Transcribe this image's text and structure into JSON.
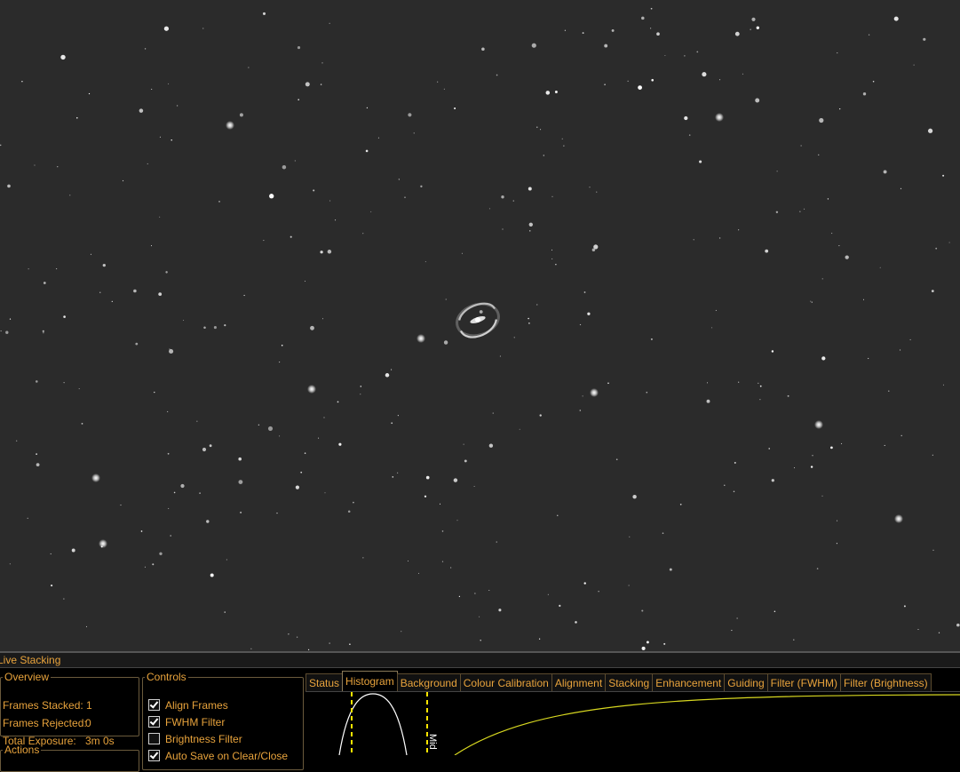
{
  "panel": {
    "title": "Live Stacking",
    "overview": {
      "legend": "Overview",
      "frames_stacked_label": "Frames Stacked:",
      "frames_stacked_value": "1",
      "frames_rejected_label": "Frames Rejected:",
      "frames_rejected_value": "0",
      "total_exposure_label": "Total Exposure:",
      "total_exposure_value": "3m 0s"
    },
    "actions": {
      "legend": "Actions"
    },
    "controls": {
      "legend": "Controls",
      "items": [
        {
          "label": "Align Frames",
          "checked": true
        },
        {
          "label": "FWHM Filter",
          "checked": true
        },
        {
          "label": "Brightness Filter",
          "checked": false
        },
        {
          "label": "Auto Save on Clear/Close",
          "checked": true
        }
      ]
    },
    "tabs": [
      {
        "label": "Status",
        "active": false
      },
      {
        "label": "Histogram",
        "active": true
      },
      {
        "label": "Background",
        "active": false
      },
      {
        "label": "Colour Calibration",
        "active": false
      },
      {
        "label": "Alignment",
        "active": false
      },
      {
        "label": "Stacking",
        "active": false
      },
      {
        "label": "Enhancement",
        "active": false
      },
      {
        "label": "Guiding",
        "active": false
      },
      {
        "label": "Filter (FWHM)",
        "active": false
      },
      {
        "label": "Filter (Brightness)",
        "active": false
      }
    ],
    "histogram": {
      "mid_marker_label": "Mid"
    }
  },
  "colors": {
    "accent_text": "#e8a33c",
    "sky_background": "#2b2b2b",
    "panel_background": "#000000",
    "marker_yellow": "#ffe600",
    "curve_yellow": "#d8d820"
  }
}
